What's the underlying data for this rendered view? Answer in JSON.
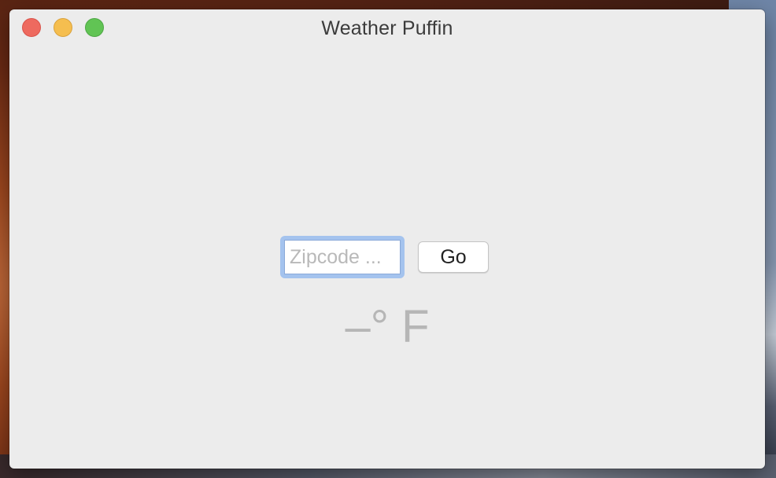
{
  "window": {
    "title": "Weather Puffin"
  },
  "traffic_lights": {
    "close_color": "#ee6a5f",
    "minimize_color": "#f5be4f",
    "zoom_color": "#61c454"
  },
  "search": {
    "zip_value": "",
    "zip_placeholder": "Zipcode ...",
    "go_label": "Go"
  },
  "weather": {
    "temperature_display": "–° F"
  },
  "colors": {
    "focus_ring": "#a4c3ee",
    "window_bg": "#ececec",
    "temperature_text": "#b6b6b6"
  }
}
